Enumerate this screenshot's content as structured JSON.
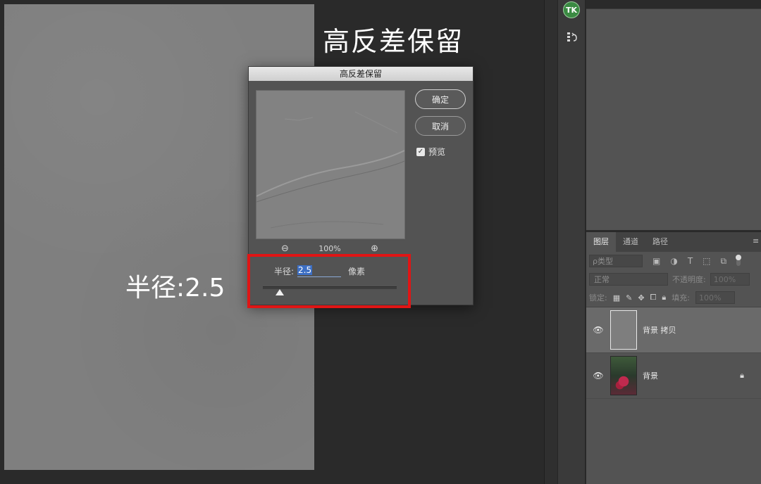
{
  "captions": {
    "filter_name": "高反差保留",
    "radius_note": "半径:2.5"
  },
  "dialog": {
    "title": "高反差保留",
    "ok_label": "确定",
    "cancel_label": "取消",
    "preview_label": "预览",
    "preview_checked": true,
    "zoom_level": "100%",
    "radius_label": "半径:",
    "radius_value": "2.5",
    "radius_unit": "像素"
  },
  "toolstrip": {
    "plugin_badge": "TK"
  },
  "layers_panel": {
    "tabs": [
      {
        "label": "图层",
        "active": true
      },
      {
        "label": "通道",
        "active": false
      },
      {
        "label": "路径",
        "active": false
      }
    ],
    "filter_placeholder": "ρ类型",
    "blend_mode": "正常",
    "opacity_label": "不透明度:",
    "opacity_value": "100%",
    "lock_label": "锁定:",
    "fill_label": "填充:",
    "fill_value": "100%",
    "layers": [
      {
        "name": "背景 拷贝",
        "selected": true,
        "locked": false
      },
      {
        "name": "背景",
        "selected": false,
        "locked": true
      }
    ]
  },
  "colors": {
    "highlight": "#e01515",
    "canvas": "#7f7f7f",
    "plugin_badge": "#3a8a42"
  }
}
